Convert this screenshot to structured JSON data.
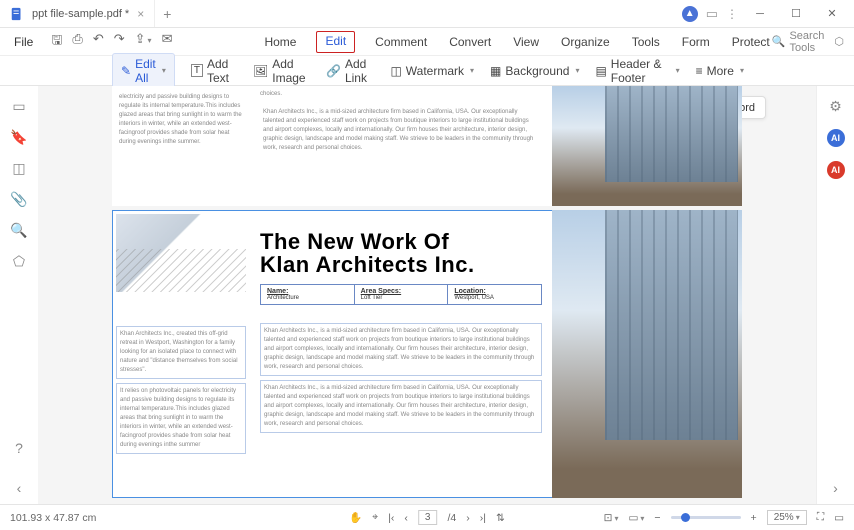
{
  "titlebar": {
    "tab_title": "ppt file-sample.pdf *"
  },
  "menubar": {
    "file": "File",
    "tabs": [
      "Home",
      "Edit",
      "Comment",
      "Convert",
      "View",
      "Organize",
      "Tools",
      "Form",
      "Protect"
    ],
    "active_tab": "Edit",
    "search_placeholder": "Search Tools"
  },
  "toolbar": {
    "edit_all": "Edit All",
    "add_text": "Add Text",
    "add_image": "Add Image",
    "add_link": "Add Link",
    "watermark": "Watermark",
    "background": "Background",
    "header_footer": "Header & Footer",
    "more": "More"
  },
  "float": {
    "pdf_to_word": "PDF To Word"
  },
  "doc": {
    "title_line1": "The New Work Of",
    "title_line2": "Klan Architects Inc.",
    "info": [
      {
        "h": "Name:",
        "v": "Architecture"
      },
      {
        "h": "Area Specs:",
        "v": "Loft Tier"
      },
      {
        "h": "Location:",
        "v": "Westport, USA"
      }
    ],
    "para_small_a": "electricity and passive building designs to regulate its internal temperature.This includes glazed areas that bring sunlight in to warm the interiors in winter, while an extended west-facingroof provides shade from solar heat during evenings inthe summer.",
    "para_small_intro": "Khan Architects Inc., created this off-grid retreat in Westport, Washington for a family looking for an isolated place to connect with nature and \"distance themselves from social stresses\".",
    "para_small_b": "It relies on photovoltaic panels for electricity and passive building designs to regulate its internal temperature.This includes glazed areas that bring sunlight in to warm the interiors in winter, while an extended west-facingroof provides shade from solar heat during evenings inthe summer",
    "para_main": "Khan Architects Inc., is a mid-sized architecture firm based in California, USA. Our exceptionally talented and experienced staff work on projects from boutique interiors to large institutional buildings and airport complexes, locally and internationally. Our firm houses their architecture, interior design, graphic design, landscape and model making staff. We strieve to be leaders in the community through work, research and personal choices."
  },
  "statusbar": {
    "dims": "101.93 x 47.87 cm",
    "page": "3",
    "total": "/4",
    "zoom": "25%"
  }
}
